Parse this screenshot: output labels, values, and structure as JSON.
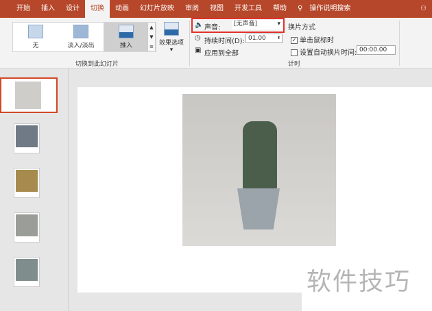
{
  "tabs": [
    "开始",
    "插入",
    "设计",
    "切换",
    "动画",
    "幻灯片放映",
    "审阅",
    "视图",
    "开发工具",
    "帮助"
  ],
  "search": "操作说明搜索",
  "user_icon": "person-icon",
  "gallery": [
    "无",
    "淡入/淡出",
    "推入"
  ],
  "effect_options": "效果选项",
  "group_transition": "切换到此幻灯片",
  "sound_label": "声音:",
  "sound_value": "[无声音]",
  "duration_label": "持续时间(D):",
  "duration_value": "01.00",
  "apply_all": "应用到全部",
  "advance_title": "换片方式",
  "on_click": "单击鼠标时",
  "auto_after": "设置自动换片时间:",
  "auto_value": "00:00.00",
  "group_timing": "计时",
  "watermark": "软件技巧"
}
